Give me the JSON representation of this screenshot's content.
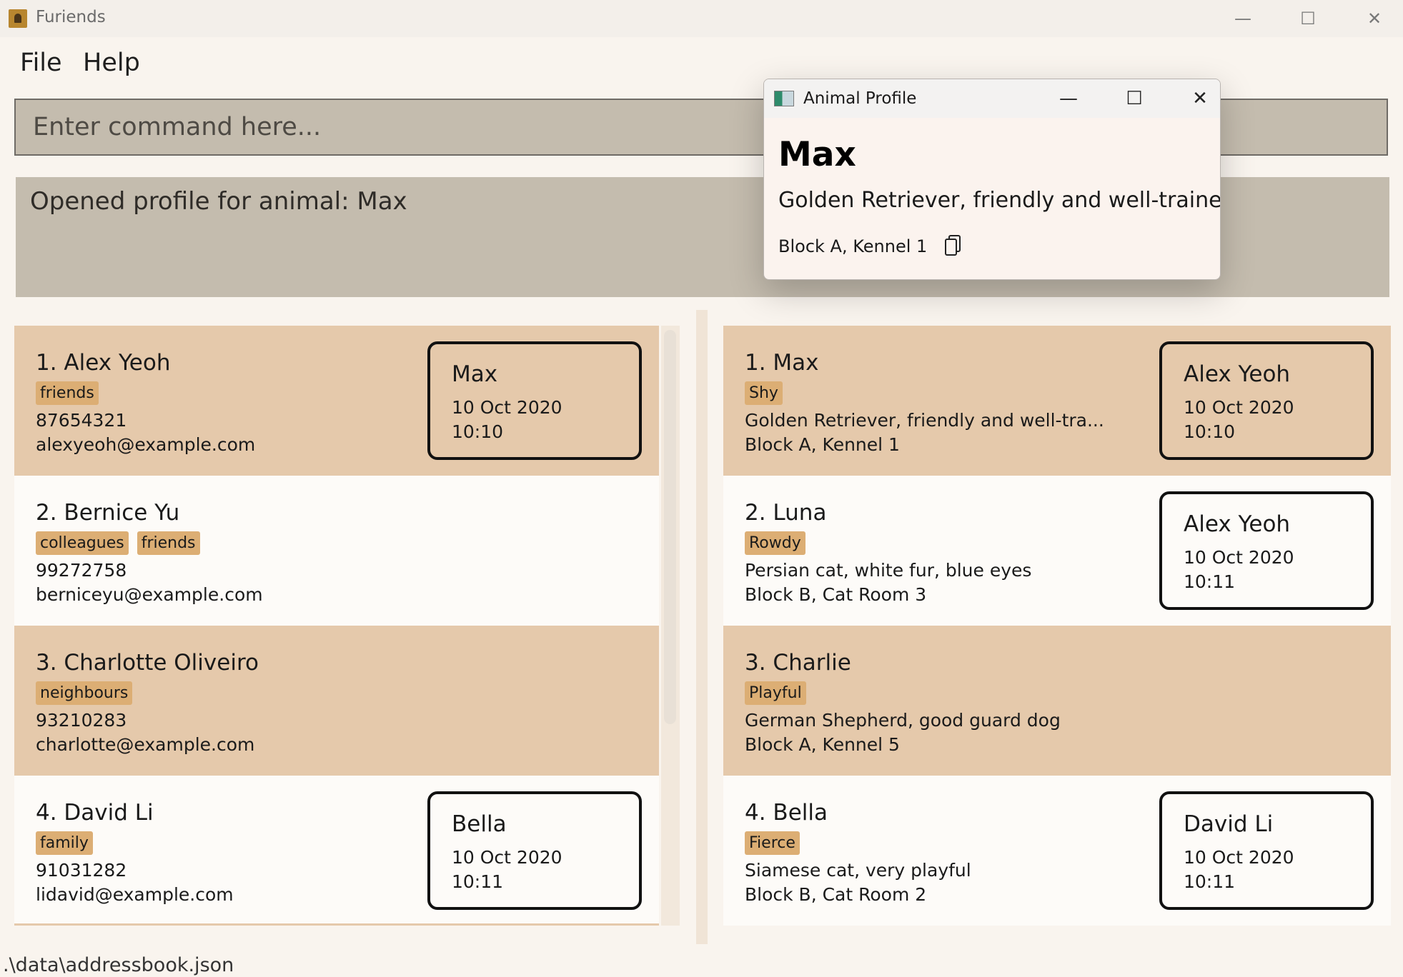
{
  "window": {
    "title": "Furiends",
    "minimize": "—",
    "maximize": "☐",
    "close": "✕"
  },
  "menu": {
    "file": "File",
    "help": "Help"
  },
  "command": {
    "placeholder": "Enter command here..."
  },
  "result": {
    "text": "Opened profile for animal: Max"
  },
  "persons": [
    {
      "title": "1. Alex Yeoh",
      "tags": [
        "friends"
      ],
      "phone": "87654321",
      "email": "alexyeoh@example.com",
      "appointment": {
        "name": "Max",
        "date": "10 Oct 2020",
        "time": "10:10"
      }
    },
    {
      "title": "2. Bernice Yu",
      "tags": [
        "colleagues",
        "friends"
      ],
      "phone": "99272758",
      "email": "berniceyu@example.com"
    },
    {
      "title": "3. Charlotte Oliveiro",
      "tags": [
        "neighbours"
      ],
      "phone": "93210283",
      "email": "charlotte@example.com"
    },
    {
      "title": "4. David Li",
      "tags": [
        "family"
      ],
      "phone": "91031282",
      "email": "lidavid@example.com",
      "appointment": {
        "name": "Bella",
        "date": "10 Oct 2020",
        "time": "10:11"
      }
    }
  ],
  "animals": [
    {
      "title": "1. Max",
      "tags": [
        "Shy"
      ],
      "description": "Golden Retriever, friendly and well-tra...",
      "location": "Block A, Kennel 1",
      "appointment": {
        "name": "Alex Yeoh",
        "date": "10 Oct 2020",
        "time": "10:10"
      }
    },
    {
      "title": "2. Luna",
      "tags": [
        "Rowdy"
      ],
      "description": "Persian cat, white fur, blue eyes",
      "location": "Block B, Cat Room 3",
      "appointment": {
        "name": "Alex Yeoh",
        "date": "10 Oct 2020",
        "time": "10:11"
      }
    },
    {
      "title": "3. Charlie",
      "tags": [
        "Playful"
      ],
      "description": "German Shepherd, good guard dog",
      "location": "Block A, Kennel 5"
    },
    {
      "title": "4. Bella",
      "tags": [
        "Fierce"
      ],
      "description": "Siamese cat, very playful",
      "location": "Block B, Cat Room 2",
      "appointment": {
        "name": "David Li",
        "date": "10 Oct 2020",
        "time": "10:11"
      }
    }
  ],
  "status": {
    "path": ".\\data\\addressbook.json"
  },
  "profile_dialog": {
    "title": "Animal Profile",
    "name": "Max",
    "description": "Golden Retriever, friendly and well-trained",
    "location": "Block A, Kennel 1",
    "minimize": "—",
    "maximize": "☐",
    "close": "✕"
  }
}
